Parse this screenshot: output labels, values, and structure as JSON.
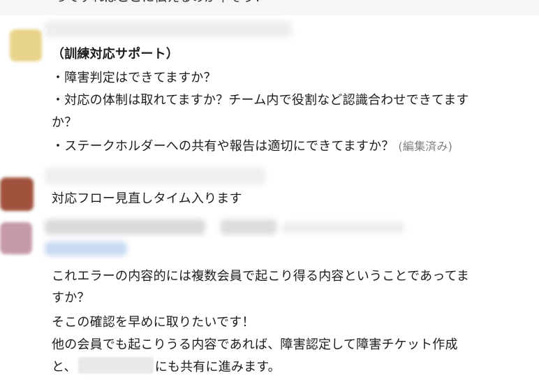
{
  "top_partial_text": "ってすればここに伝えるのが早そう！",
  "message1": {
    "heading": "（訓練対応サポート）",
    "lines": [
      "・障害判定はできてますか？",
      "・対応の体制は取れてますか？チーム内で役割など認識合わせできてます",
      "か？",
      "・ステークホルダーへの共有や報告は適切にできてますか？"
    ],
    "edited_label": "(編集済み)"
  },
  "message2": {
    "text": "対応フロー見直しタイム入ります"
  },
  "message3": {
    "lines": [
      "これエラーの内容的には複数会員で起こり得る内容ということであってま",
      "すか？",
      "そこの確認を早めに取りたいです！",
      "他の会員でも起こりうる内容であれば、障害認定して障害チケット作成"
    ],
    "last_prefix": "と、",
    "last_suffix": "にも共有に進みます。"
  },
  "colors": {
    "avatar1": "#e8d38a",
    "avatar2": "#a0523d",
    "avatar3": "#c79aa8",
    "blur_link": "#c7d9f2"
  }
}
